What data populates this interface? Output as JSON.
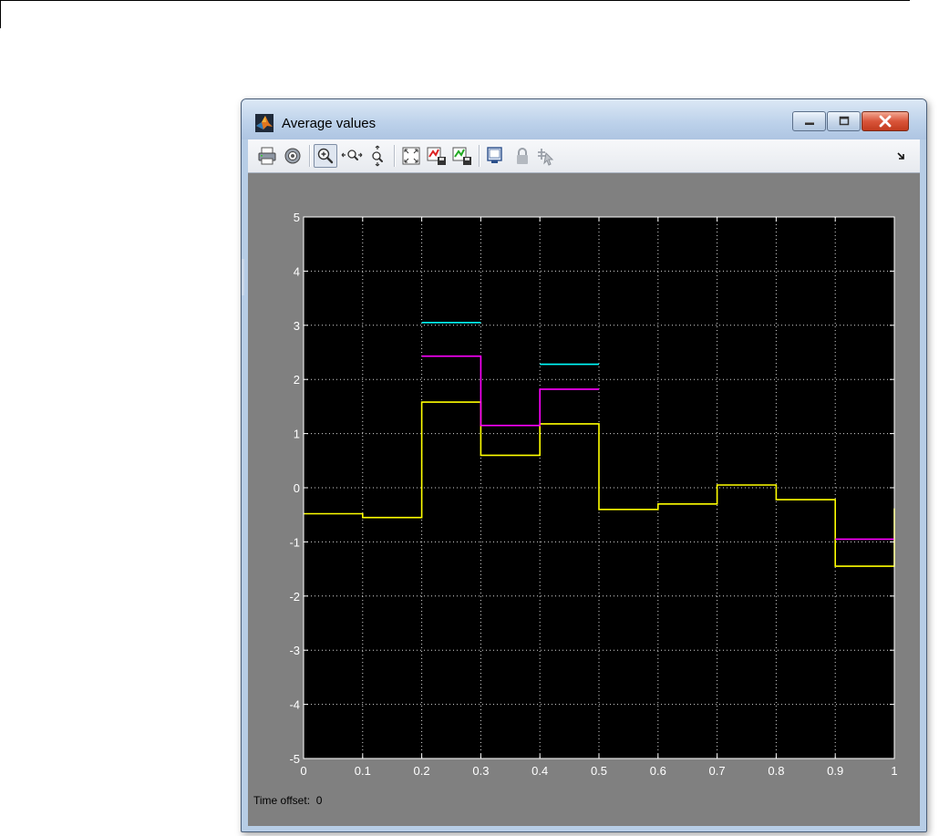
{
  "window": {
    "title": "Average values",
    "controls": {
      "minimize": "minimize",
      "maximize": "maximize",
      "close": "close"
    }
  },
  "toolbar": {
    "items": [
      "print-icon",
      "parameters-icon",
      "zoom-in-icon",
      "zoom-x-icon",
      "zoom-y-icon",
      "autoscale-icon",
      "save-axes-icon",
      "restore-axes-icon",
      "floating-scope-icon",
      "lock-icon",
      "signal-selection-icon"
    ],
    "expand_icon": "chevron-icon"
  },
  "status": {
    "time_offset_label": "Time offset:",
    "time_offset_value": "0"
  },
  "colors": {
    "plot_bg": "#000000",
    "figure_bg": "#808080",
    "axis": "#ffffff",
    "grid": "#ffffff",
    "series": [
      "#ffff00",
      "#ff00ff",
      "#00ffff"
    ]
  },
  "chart_data": {
    "type": "line",
    "xlim": [
      0,
      1
    ],
    "ylim": [
      -5,
      5
    ],
    "x_ticks": [
      "0",
      "0.1",
      "0.2",
      "0.3",
      "0.4",
      "0.5",
      "0.6",
      "0.7",
      "0.8",
      "0.9",
      "1"
    ],
    "y_ticks": [
      "5",
      "4",
      "3",
      "2",
      "1",
      "0",
      "-1",
      "-2",
      "-3",
      "-4",
      "-5"
    ],
    "grid": true,
    "legend": "none",
    "series": [
      {
        "color": "#ffff00",
        "segments": [
          {
            "points": [
              [
                0,
                -0.48
              ],
              [
                0.1,
                -0.48
              ],
              [
                0.1,
                -0.55
              ],
              [
                0.2,
                -0.55
              ],
              [
                0.2,
                1.58
              ],
              [
                0.3,
                1.58
              ],
              [
                0.3,
                0.6
              ],
              [
                0.4,
                0.6
              ],
              [
                0.4,
                1.18
              ],
              [
                0.5,
                1.18
              ],
              [
                0.5,
                -0.4
              ],
              [
                0.6,
                -0.4
              ],
              [
                0.6,
                -0.3
              ],
              [
                0.7,
                -0.3
              ],
              [
                0.7,
                0.05
              ],
              [
                0.8,
                0.05
              ],
              [
                0.8,
                -0.22
              ],
              [
                0.9,
                -0.22
              ],
              [
                0.9,
                -1.45
              ],
              [
                1.0,
                -1.45
              ],
              [
                1.0,
                -0.38
              ]
            ]
          }
        ]
      },
      {
        "color": "#ff00ff",
        "segments": [
          {
            "points": [
              [
                0.2,
                2.43
              ],
              [
                0.3,
                2.43
              ],
              [
                0.3,
                1.15
              ],
              [
                0.4,
                1.15
              ],
              [
                0.4,
                1.82
              ],
              [
                0.5,
                1.82
              ]
            ]
          },
          {
            "points": [
              [
                0.9,
                -0.95
              ],
              [
                1.0,
                -0.95
              ]
            ]
          }
        ]
      },
      {
        "color": "#00ffff",
        "segments": [
          {
            "points": [
              [
                0.2,
                3.05
              ],
              [
                0.3,
                3.05
              ]
            ]
          },
          {
            "points": [
              [
                0.4,
                2.28
              ],
              [
                0.5,
                2.28
              ]
            ]
          }
        ]
      }
    ]
  }
}
